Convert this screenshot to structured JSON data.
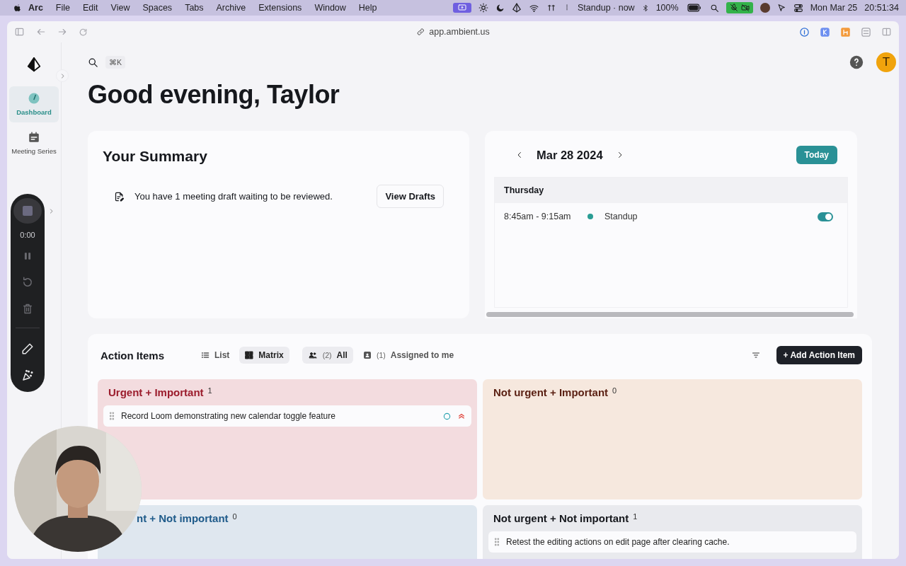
{
  "menu_bar": {
    "app": "Arc",
    "menus": [
      "File",
      "Edit",
      "View",
      "Spaces",
      "Tabs",
      "Archive",
      "Extensions",
      "Window",
      "Help"
    ],
    "meeting": "Standup · now",
    "battery": "100%",
    "date": "Mon Mar 25",
    "time": "20:51:34"
  },
  "browser": {
    "url": "app.ambient.us"
  },
  "sidebar": {
    "items": [
      {
        "label": "Dashboard",
        "kind": "dashboard",
        "selected": true
      },
      {
        "label": "Meeting Series",
        "kind": "calendar",
        "selected": false
      }
    ]
  },
  "recorder": {
    "timer": "0:00"
  },
  "search": {
    "shortcut": "⌘K"
  },
  "user": {
    "initial": "T"
  },
  "greeting": "Good evening, Taylor",
  "summary": {
    "title": "Your Summary",
    "message": "You have 1 meeting draft waiting to be reviewed.",
    "button": "View Drafts"
  },
  "calendar": {
    "date": "Mar 28 2024",
    "today_button": "Today",
    "day": "Thursday",
    "events": [
      {
        "time": "8:45am - 9:15am",
        "title": "Standup",
        "color": "#2a9d94",
        "on": true
      }
    ]
  },
  "action_items": {
    "title": "Action Items",
    "views": [
      {
        "label": "List",
        "kind": "list",
        "selected": false
      },
      {
        "label": "Matrix",
        "kind": "matrix",
        "selected": true
      }
    ],
    "filters": [
      {
        "count": "(2)",
        "label": "All",
        "kind": "group",
        "selected": true
      },
      {
        "count": "(1)",
        "label": "Assigned to me",
        "kind": "person",
        "selected": false
      }
    ],
    "add_button": "+ Add Action Item",
    "quadrants": [
      {
        "kind": "urgent-important",
        "title": "Urgent + Important",
        "count": "1",
        "items": [
          {
            "text": "Record Loom demonstrating new calendar toggle feature",
            "marked": true
          }
        ]
      },
      {
        "kind": "important",
        "title": "Not urgent + Important",
        "count": "0"
      },
      {
        "kind": "urgent",
        "title": "nt + Not important",
        "count": "0"
      },
      {
        "kind": "neither",
        "title": "Not urgent + Not important",
        "count": "1",
        "items": [
          {
            "text": "Retest the editing actions on edit page after clearing cache.",
            "marked": false
          }
        ]
      }
    ]
  }
}
